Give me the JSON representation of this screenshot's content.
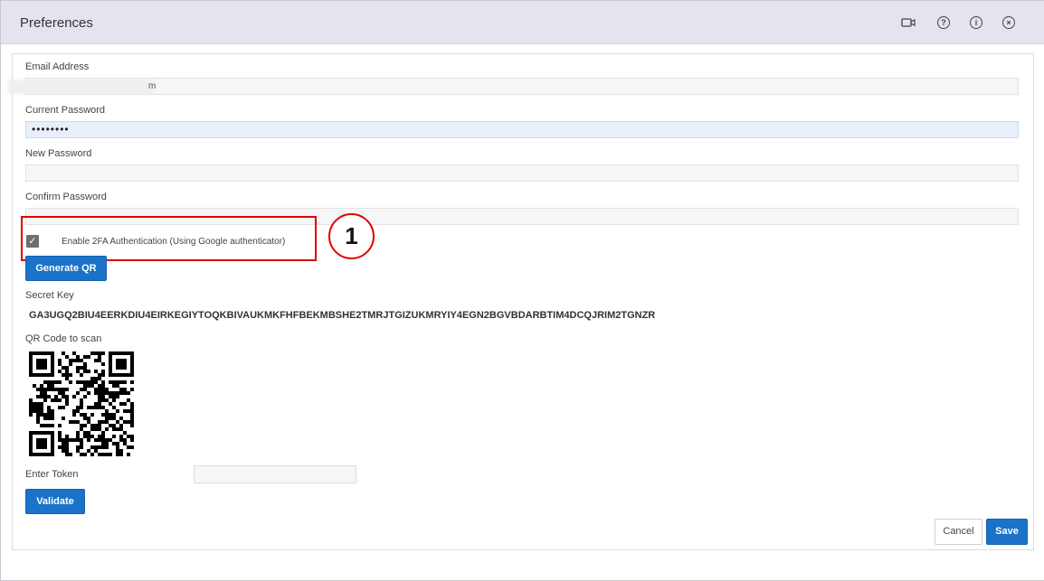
{
  "window": {
    "title": "Preferences",
    "icons": [
      "video-icon",
      "help-icon",
      "info-icon",
      "close-icon"
    ]
  },
  "form": {
    "email_label": "Email Address",
    "email_value_visible": "m",
    "current_password_label": "Current Password",
    "current_password_value": "••••••••",
    "new_password_label": "New Password",
    "new_password_value": "",
    "confirm_password_label": "Confirm Password",
    "confirm_password_value": "",
    "enable_2fa_label": "Enable 2FA Authentication (Using Google authenticator)",
    "enable_2fa_checked": true,
    "generate_qr_label": "Generate QR",
    "secret_key_label": "Secret Key",
    "secret_key_value": "GA3UGQ2BIU4EERKDIU4EIRKEGIYTOQKBIVAUKMKFHFBEKMBSHE2TMRJTGIZUKMRYIY4EGN2BGVBDARBTIM4DCQJRIM2TGNZR",
    "qr_label": "QR Code to scan",
    "enter_token_label": "Enter Token",
    "enter_token_value": "",
    "validate_label": "Validate"
  },
  "annotation": {
    "callout_number": "1",
    "color": "#e00000"
  },
  "footer": {
    "cancel_label": "Cancel",
    "save_label": "Save"
  },
  "colors": {
    "primary": "#1a73c8",
    "titlebar": "#e4e4ee"
  }
}
